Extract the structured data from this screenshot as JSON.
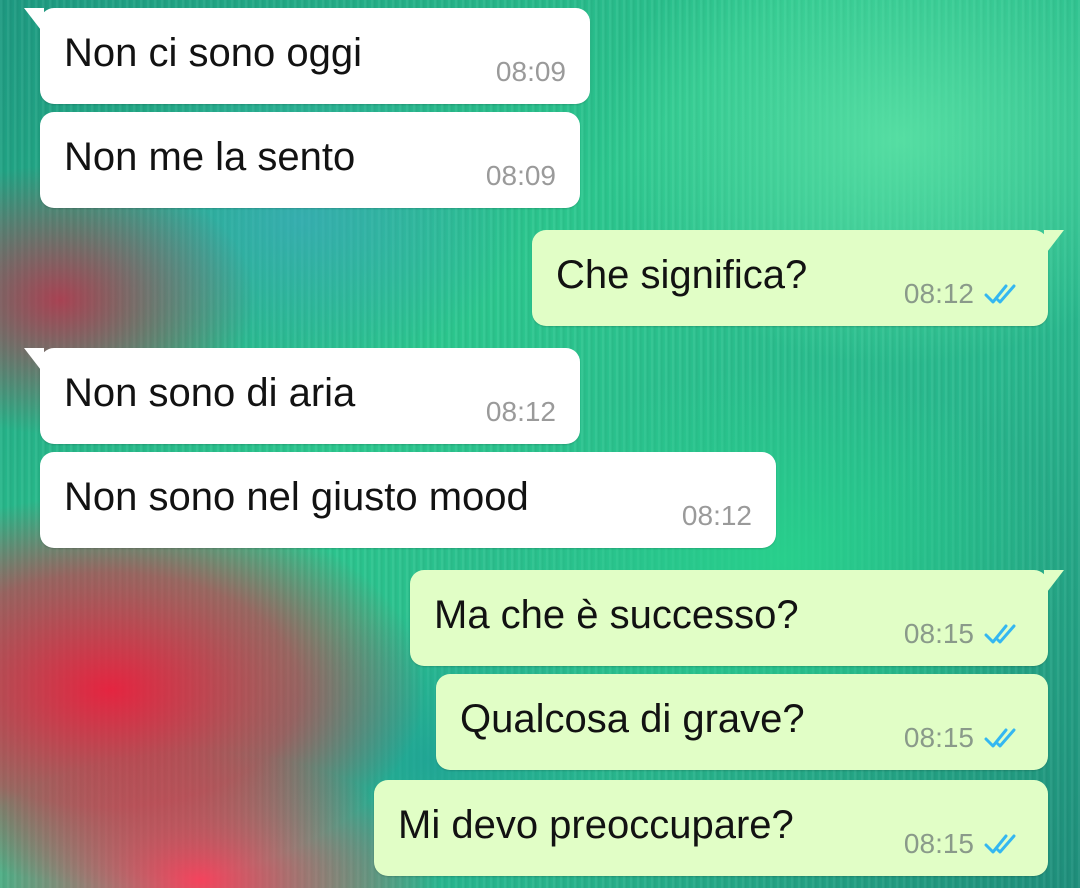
{
  "messages": [
    {
      "direction": "in",
      "text": "Non ci sono oggi",
      "time": "08:09"
    },
    {
      "direction": "in",
      "text": "Non me la sento",
      "time": "08:09"
    },
    {
      "direction": "out",
      "text": "Che significa?",
      "time": "08:12",
      "status": "read"
    },
    {
      "direction": "in",
      "text": "Non sono di aria",
      "time": "08:12"
    },
    {
      "direction": "in",
      "text": "Non sono nel giusto mood",
      "time": "08:12"
    },
    {
      "direction": "out",
      "text": "Ma che è successo?",
      "time": "08:15",
      "status": "read"
    },
    {
      "direction": "out",
      "text": "Qualcosa di grave?",
      "time": "08:15",
      "status": "read"
    },
    {
      "direction": "out",
      "text": "Mi devo preoccupare?",
      "time": "08:15",
      "status": "read"
    }
  ],
  "colors": {
    "incoming_bubble": "#ffffff",
    "outgoing_bubble": "#e1fec6",
    "read_ticks": "#34b7f1",
    "timestamp": "#9a9a9a"
  },
  "icons": {
    "read_status": "double-check-icon"
  }
}
